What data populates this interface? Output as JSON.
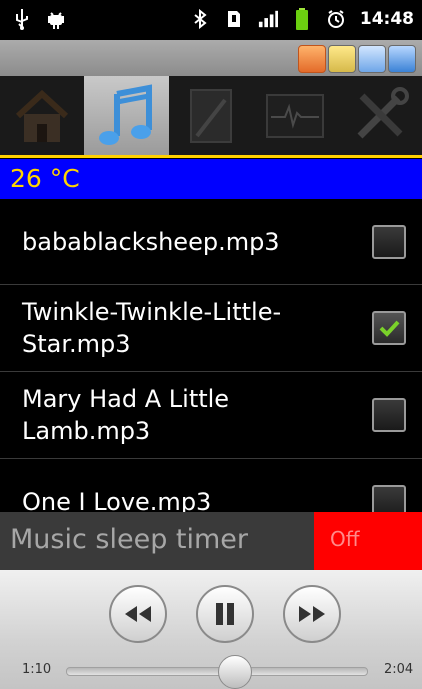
{
  "status_bar": {
    "time": "14:48",
    "icons": [
      "usb-icon",
      "android-debug-icon",
      "bluetooth-icon",
      "sim-icon",
      "signal-icon",
      "battery-icon",
      "alarm-icon"
    ]
  },
  "app_topbar": {
    "icons": [
      "app-icon",
      "speaker-icon",
      "weather-icon",
      "signal-badge-icon"
    ]
  },
  "tabs": [
    {
      "name": "home",
      "icon": "home-icon",
      "active": false
    },
    {
      "name": "music",
      "icon": "music-note-icon",
      "active": true
    },
    {
      "name": "notes",
      "icon": "notebook-icon",
      "active": false
    },
    {
      "name": "monitor",
      "icon": "waveform-icon",
      "active": false
    },
    {
      "name": "settings",
      "icon": "tools-icon",
      "active": false
    }
  ],
  "temperature": "26 °C",
  "songs": [
    {
      "name": "bababl­acksheep.mp3",
      "checked": false
    },
    {
      "name": "Twinkle-Twinkle-Little-Star.mp3",
      "checked": true
    },
    {
      "name": "Mary Had A Little Lamb.mp3",
      "checked": false
    },
    {
      "name": "One I Love.mp3",
      "checked": false
    }
  ],
  "sleep_timer": {
    "label": "Music sleep timer",
    "state": "Off"
  },
  "player": {
    "elapsed": "1:10",
    "duration": "2:04",
    "progress_fraction": 0.56
  }
}
